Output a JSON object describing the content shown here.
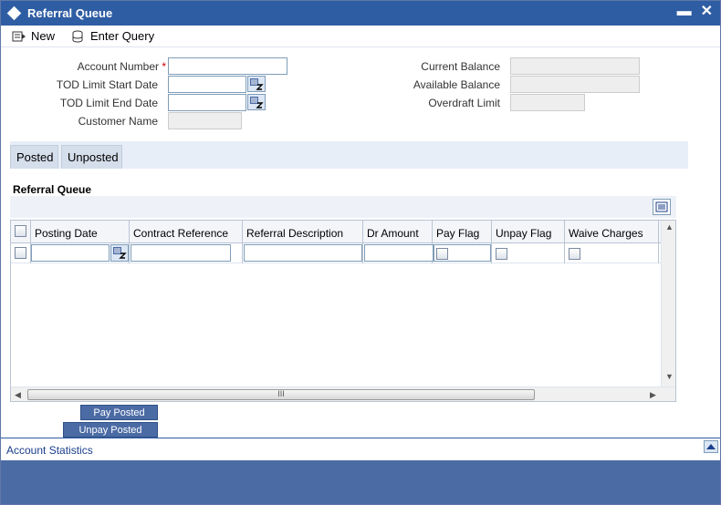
{
  "window": {
    "title": "Referral Queue",
    "minimize": "▬",
    "close": "✕"
  },
  "toolbar": {
    "new_label": "New",
    "enter_query_label": "Enter Query"
  },
  "form": {
    "account_number_label": "Account Number",
    "required_mark": "*",
    "account_number_value": "",
    "tod_start_label": "TOD Limit Start Date",
    "tod_start_value": "",
    "tod_end_label": "TOD Limit End Date",
    "tod_end_value": "",
    "customer_name_label": "Customer Name",
    "customer_name_value": "",
    "current_balance_label": "Current Balance",
    "current_balance_value": "",
    "available_balance_label": "Available Balance",
    "available_balance_value": "",
    "overdraft_limit_label": "Overdraft Limit",
    "overdraft_limit_value": ""
  },
  "tabs": [
    {
      "label": "Posted"
    },
    {
      "label": "Unposted"
    }
  ],
  "section": {
    "title": "Referral Queue"
  },
  "grid": {
    "columns": [
      "Posting Date",
      "Contract Reference",
      "Referral Description",
      "Dr Amount",
      "Pay Flag",
      "Unpay Flag",
      "Waive Charges"
    ],
    "scroll_thumb": "III"
  },
  "actions": {
    "pay_posted": "Pay Posted",
    "unpay_posted": "Unpay Posted"
  },
  "footer": {
    "account_statistics": "Account Statistics"
  },
  "colors": {
    "title_bar": "#2f5da3",
    "button": "#4b6ba5",
    "bottom_band": "#4b6ba5"
  },
  "icons": {
    "title": "diamond-icon",
    "new": "new-record-icon",
    "query": "enter-query-icon",
    "calendar": "calendar-icon",
    "grid_menu": "list-icon"
  }
}
